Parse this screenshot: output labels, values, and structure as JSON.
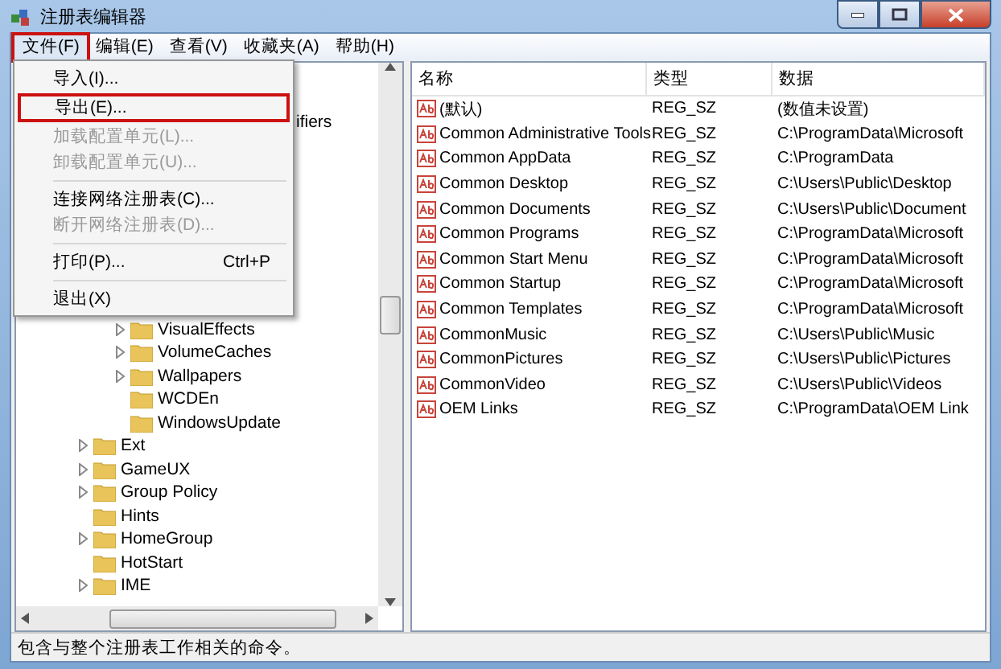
{
  "window": {
    "title": "注册表编辑器"
  },
  "menubar": [
    {
      "label": "文件(F)",
      "selected": true,
      "highlighted": true
    },
    {
      "label": "编辑(E)",
      "selected": false,
      "highlighted": false
    },
    {
      "label": "查看(V)",
      "selected": false,
      "highlighted": false
    },
    {
      "label": "收藏夹(A)",
      "selected": false,
      "highlighted": false
    },
    {
      "label": "帮助(H)",
      "selected": false,
      "highlighted": false
    }
  ],
  "file_menu": [
    {
      "kind": "item",
      "label": "导入(I)...",
      "disabled": false,
      "highlighted": false
    },
    {
      "kind": "item",
      "label": "导出(E)...",
      "disabled": false,
      "highlighted": true
    },
    {
      "kind": "item",
      "label": "加载配置单元(L)...",
      "disabled": true,
      "highlighted": false
    },
    {
      "kind": "item",
      "label": "卸载配置单元(U)...",
      "disabled": true,
      "highlighted": false
    },
    {
      "kind": "separator"
    },
    {
      "kind": "item",
      "label": "连接网络注册表(C)...",
      "disabled": false,
      "highlighted": false
    },
    {
      "kind": "item",
      "label": "断开网络注册表(D)...",
      "disabled": true,
      "highlighted": false
    },
    {
      "kind": "separator"
    },
    {
      "kind": "item",
      "label": "打印(P)...",
      "shortcut": "Ctrl+P",
      "disabled": false,
      "highlighted": false
    },
    {
      "kind": "separator"
    },
    {
      "kind": "item",
      "label": "退出(X)",
      "disabled": false,
      "highlighted": false
    }
  ],
  "tree": {
    "items": [
      {
        "label": "ifiers",
        "children": [
          {
            "label": "VisualEffects",
            "has_children": true
          },
          {
            "label": "VolumeCaches",
            "has_children": true
          },
          {
            "label": "Wallpapers",
            "has_children": true
          },
          {
            "label": "WCDEn",
            "has_children": false
          },
          {
            "label": "WindowsUpdate",
            "has_children": false
          }
        ]
      },
      {
        "label": "Ext",
        "has_children": true
      },
      {
        "label": "GameUX",
        "has_children": true
      },
      {
        "label": "Group Policy",
        "has_children": true
      },
      {
        "label": "Hints",
        "has_children": false
      },
      {
        "label": "HomeGroup",
        "has_children": true
      },
      {
        "label": "HotStart",
        "has_children": false
      },
      {
        "label": "IME",
        "has_children": true
      }
    ]
  },
  "values": {
    "columns": [
      "名称",
      "类型",
      "数据"
    ],
    "rows": [
      [
        "(默认)",
        "REG_SZ",
        "(数值未设置)"
      ],
      [
        "Common Administrative Tools",
        "REG_SZ",
        "C:\\ProgramData\\Microsoft"
      ],
      [
        "Common AppData",
        "REG_SZ",
        "C:\\ProgramData"
      ],
      [
        "Common Desktop",
        "REG_SZ",
        "C:\\Users\\Public\\Desktop"
      ],
      [
        "Common Documents",
        "REG_SZ",
        "C:\\Users\\Public\\Document"
      ],
      [
        "Common Programs",
        "REG_SZ",
        "C:\\ProgramData\\Microsoft"
      ],
      [
        "Common Start Menu",
        "REG_SZ",
        "C:\\ProgramData\\Microsoft"
      ],
      [
        "Common Startup",
        "REG_SZ",
        "C:\\ProgramData\\Microsoft"
      ],
      [
        "Common Templates",
        "REG_SZ",
        "C:\\ProgramData\\Microsoft"
      ],
      [
        "CommonMusic",
        "REG_SZ",
        "C:\\Users\\Public\\Music"
      ],
      [
        "CommonPictures",
        "REG_SZ",
        "C:\\Users\\Public\\Pictures"
      ],
      [
        "CommonVideo",
        "REG_SZ",
        "C:\\Users\\Public\\Videos"
      ],
      [
        "OEM Links",
        "REG_SZ",
        "C:\\ProgramData\\OEM Link"
      ]
    ]
  },
  "status_bar": "包含与整个注册表工作相关的命令。"
}
